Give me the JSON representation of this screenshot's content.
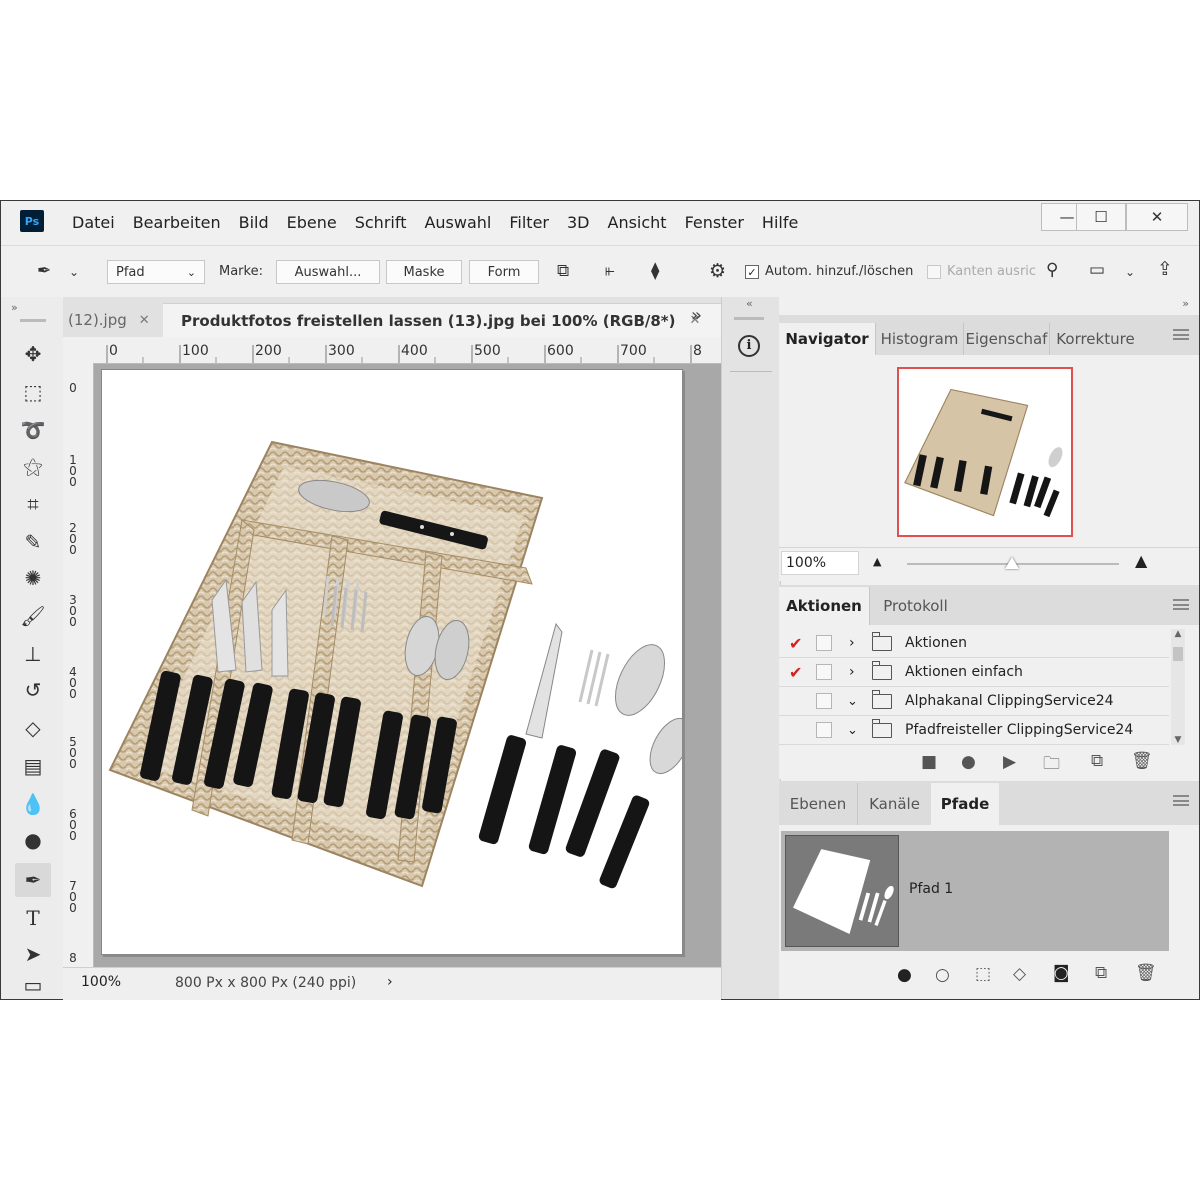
{
  "app_logo": "Ps",
  "menu": [
    "Datei",
    "Bearbeiten",
    "Bild",
    "Ebene",
    "Schrift",
    "Auswahl",
    "Filter",
    "3D",
    "Ansicht",
    "Fenster",
    "Hilfe"
  ],
  "window_controls": {
    "minimize": "—",
    "maximize": "☐",
    "close": "✕"
  },
  "options": {
    "mode_value": "Pfad",
    "marke_label": "Marke:",
    "selection_button": "Auswahl...",
    "mask_button": "Maske",
    "shape_button": "Form",
    "auto_add_delete": "Autom. hinzuf./löschen",
    "align_edges": "Kanten ausric"
  },
  "tabs": {
    "first": "(12).jpg",
    "active": "Produktfotos freistellen lassen (13).jpg bei 100% (RGB/8*)",
    "close_glyph": "✕",
    "overflow": "»"
  },
  "ruler": {
    "top": [
      "0",
      "100",
      "200",
      "300",
      "400",
      "500",
      "600",
      "700",
      "8"
    ],
    "left": [
      "0",
      "1 0 0",
      "2 0 0",
      "3 0 0",
      "4 0 0",
      "5 0 0",
      "6 0 0",
      "7 0 0",
      "8"
    ]
  },
  "status": {
    "zoom": "100%",
    "dimensions": "800 Px x 800 Px (240 ppi)",
    "arrow": "›"
  },
  "navigator": {
    "tabs": [
      "Navigator",
      "Histogram",
      "Eigenschaf",
      "Korrekture"
    ],
    "zoom": "100%"
  },
  "actions": {
    "tabs": [
      "Aktionen",
      "Protokoll"
    ],
    "items": [
      {
        "label": "Aktionen",
        "checked": true,
        "expanded": false
      },
      {
        "label": "Aktionen einfach",
        "checked": true,
        "expanded": false
      },
      {
        "label": "Alphakanal ClippingService24",
        "checked": false,
        "expanded": true
      },
      {
        "label": "Pfadfreisteller ClippingService24",
        "checked": false,
        "expanded": true
      }
    ]
  },
  "paths": {
    "tabs": [
      "Ebenen",
      "Kanäle",
      "Pfade"
    ],
    "items": [
      {
        "label": "Pfad 1"
      }
    ]
  },
  "colors": {
    "accent_check": "#d62020",
    "nav_frame": "#e05050",
    "app_bg": "#f0f0f0"
  }
}
